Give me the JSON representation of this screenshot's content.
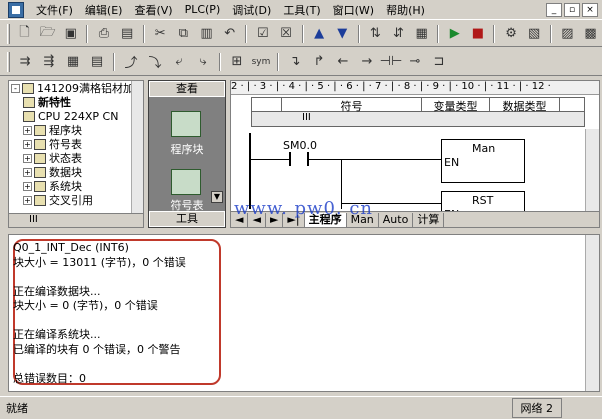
{
  "menubar": {
    "items": [
      "文件(F)",
      "编辑(E)",
      "查看(V)",
      "PLC(P)",
      "调试(D)",
      "工具(T)",
      "窗口(W)",
      "帮助(H)"
    ],
    "window_controls": [
      "_",
      "▫",
      "×"
    ]
  },
  "toolbar_icons": [
    "new-icon",
    "open-icon",
    "save-icon",
    "print-icon",
    "preview-icon",
    "cut-icon",
    "copy-icon",
    "paste-icon",
    "undo-icon",
    "compile-icon",
    "compile-all-icon",
    "upload-icon",
    "download-icon",
    "sort-asc-icon",
    "sort-desc-icon",
    "options-icon",
    "run-icon",
    "stop-icon",
    "program-status-icon",
    "chart-status-icon",
    "status-table-icon",
    "settings-icon"
  ],
  "tree": {
    "items": [
      {
        "label": "141209满格铝材加",
        "level": 0,
        "expand": "-"
      },
      {
        "label": "新特性",
        "level": 1,
        "expand": "",
        "bold": true
      },
      {
        "label": "CPU 224XP CN",
        "level": 1,
        "expand": ""
      },
      {
        "label": "程序块",
        "level": 1,
        "expand": "+"
      },
      {
        "label": "符号表",
        "level": 1,
        "expand": "+"
      },
      {
        "label": "状态表",
        "level": 1,
        "expand": "+"
      },
      {
        "label": "数据块",
        "level": 1,
        "expand": "+"
      },
      {
        "label": "系统块",
        "level": 1,
        "expand": "+"
      },
      {
        "label": "交叉引用",
        "level": 1,
        "expand": "+"
      }
    ],
    "hscroll_label": "III"
  },
  "nav": {
    "header": "查看",
    "items": [
      "程序块",
      "符号表"
    ],
    "footer": "工具"
  },
  "editor": {
    "ruler": "2 · | · 3 · | · 4 · | · 5 · | · 6 · | · 7 · | · 8 · | · 9 · | · 10 · | · 11 · | · 12 ·",
    "sym_headers": [
      "",
      "符号",
      "变量类型",
      "数据类型"
    ],
    "sym_hscroll_label": "III",
    "contact_label": "SM0.0",
    "boxes": [
      {
        "title": "Man",
        "pin": "EN"
      },
      {
        "title": "RST",
        "pin": "EN"
      }
    ],
    "tabs": [
      "主程序",
      "Man",
      "Auto",
      "计算"
    ],
    "tab_nav": [
      "◄",
      "◄",
      "►",
      "►|"
    ]
  },
  "watermark": "www. pw0. cn",
  "output": {
    "lines": [
      "Q0_1_INT_Dec (INT6)",
      "块大小 = 13011 (字节)，0 个错误",
      "",
      "正在编译数据块...",
      "块大小 = 0 (字节)，0 个错误",
      "",
      "正在编译系统块...",
      "已编译的块有 0 个错误，0 个警告",
      "",
      "总错误数目：0"
    ],
    "frame_color": "#c0392b"
  },
  "status": {
    "left": "就绪",
    "right": "网络 2"
  }
}
